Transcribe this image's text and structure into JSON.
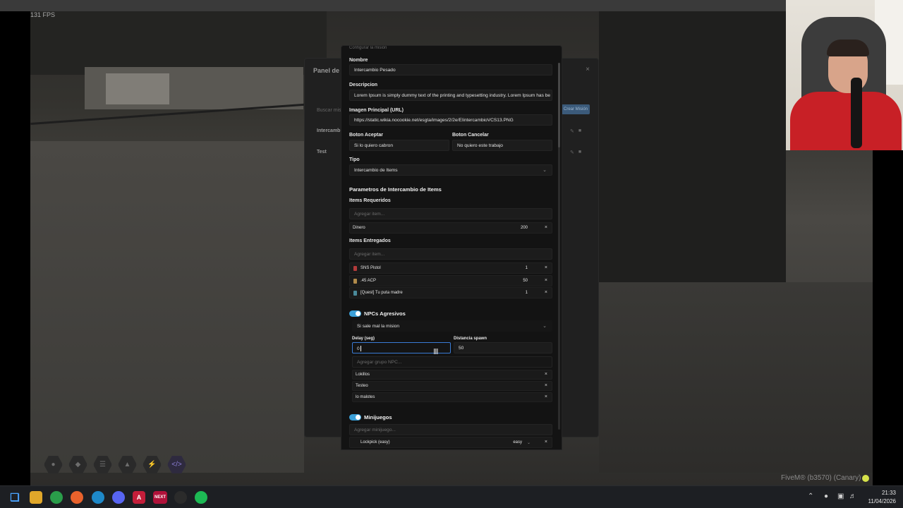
{
  "game": {
    "fps": "131 FPS",
    "platform_label": "FiveM® (b3570) (Canary)"
  },
  "bg_panel": {
    "title": "Panel de M",
    "search_placeholder": "Buscar misi",
    "rows": [
      "Intercamb",
      "Test"
    ],
    "new_button": "Crear Misión"
  },
  "modal": {
    "caption": "Configurar la misión",
    "nombre": {
      "label": "Nombre",
      "value": "Intercambio Pesado"
    },
    "descripcion": {
      "label": "Descripcion",
      "value": "Lorem Ipsum is simply dummy text of the printing and typesetting industry. Lorem Ipsum has be"
    },
    "imagen": {
      "label": "Imagen Principal (URL)",
      "value": "https://static.wikia.nocookie.net/esgta/images/2/2e/EIintercambioVCS13.PNG"
    },
    "boton_aceptar": {
      "label": "Boton Aceptar",
      "value": "Si lo quiero cabron"
    },
    "boton_cancelar": {
      "label": "Boton Cancelar",
      "value": "No quiero este trabajo"
    },
    "tipo": {
      "label": "Tipo",
      "value": "Intercambio de Items"
    },
    "params_title": "Parametros de Intercambio de Items",
    "requeridos": {
      "label": "Items Requeridos",
      "placeholder": "Agregar item...",
      "items": [
        {
          "name": "Dinero",
          "qty": "200",
          "icon_color": ""
        }
      ]
    },
    "entregados": {
      "label": "Items Entregados",
      "placeholder": "Agregar item...",
      "items": [
        {
          "name": "SNS Pistol",
          "qty": "1",
          "icon_color": "#b23a3a"
        },
        {
          "name": ".45 ACP",
          "qty": "50",
          "icon_color": "#b08a4a"
        },
        {
          "name": "[Quest] Tu puta madre",
          "qty": "1",
          "icon_color": "#4a8a9a"
        }
      ]
    },
    "npcs": {
      "title": "NPCs Agresivos",
      "enabled": true,
      "mode": "Si sale mal la mision",
      "delay": {
        "label": "Delay (seg)",
        "value": "0"
      },
      "distance": {
        "label": "Distancia spawn",
        "value": "50"
      },
      "group_placeholder": "Agregar grupo NPC...",
      "groups": [
        "Lokillos",
        "Testeo",
        "lo malotes"
      ]
    },
    "minijuegos": {
      "title": "Minijuegos",
      "enabled": true,
      "placeholder": "Agregar minijuego...",
      "items": [
        {
          "name": "Lockpick (easy)",
          "difficulty": "easy"
        }
      ]
    },
    "accent_color": "#3aa0d8",
    "close_glyph": "×"
  },
  "taskbar": {
    "apps": [
      "windows-start",
      "file-explorer",
      "chrome",
      "firefox",
      "edge",
      "discord",
      "app-a",
      "next",
      "github",
      "spotify"
    ],
    "time": "21:33",
    "date": "11/04/2026"
  }
}
